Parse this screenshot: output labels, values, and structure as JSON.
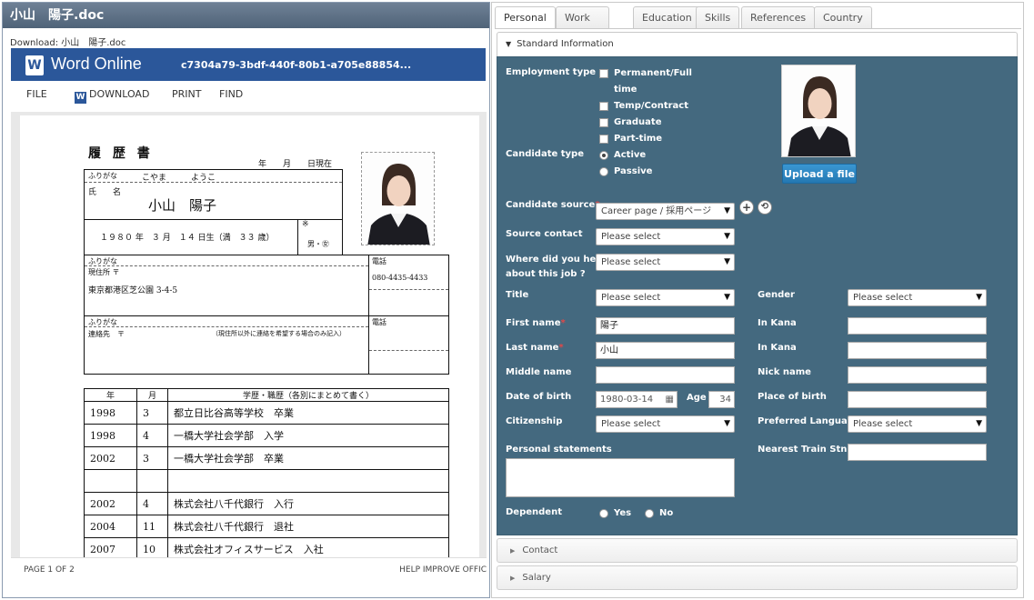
{
  "left": {
    "title": "小山　陽子.doc",
    "download_line": "Download: 小山　陽子.doc",
    "app_name": "Word Online",
    "file_id": "c7304a79-3bdf-440f-80b1-a705e88854...",
    "menu": {
      "file": "FILE",
      "download": "DOWNLOAD",
      "print": "PRINT",
      "find": "FIND"
    },
    "footer": {
      "page": "PAGE 1 OF 2",
      "help": "HELP IMPROVE OFFIC"
    }
  },
  "resume": {
    "heading": "履 歴 書",
    "date_line": "年　　月　　日現在",
    "furigana_label": "ふりがな",
    "furigana_value": "こやま　　　ようこ",
    "name_label": "氏　　名",
    "name_value": "小山　陽子",
    "birth_line": "１９８０ 年　３ 月　１４ 日生（満　３３ 歳）",
    "mark": "※",
    "gender": "男・㊛",
    "address_furigana": "ふりがな",
    "address_label": "現住所 〒",
    "address_value": "東京都港区芝公園 3-4-5",
    "phone_label": "電話",
    "phone_value": "080-4435-4433",
    "contact_furigana": "ふりがな",
    "contact_label": "連絡先　〒",
    "contact_note": "（現住所以外に連絡を希望する場合のみ記入）",
    "phone2_label": "電話",
    "history_headers": [
      "年",
      "月",
      "学歴・職歴（各別にまとめて書く）"
    ],
    "history_rows": [
      [
        "1998",
        "3",
        "都立日比谷高等学校　卒業"
      ],
      [
        "1998",
        "4",
        "一橋大学社会学部　入学"
      ],
      [
        "2002",
        "3",
        "一橋大学社会学部　卒業"
      ],
      [
        "",
        "",
        ""
      ],
      [
        "2002",
        "4",
        "株式会社八千代銀行　入行"
      ],
      [
        "2004",
        "11",
        "株式会社八千代銀行　退社"
      ],
      [
        "2007",
        "10",
        "株式会社オフィスサービス　入社"
      ]
    ]
  },
  "tabs": [
    "Personal",
    "Work History",
    "Education",
    "Skills",
    "References",
    "Country Specific"
  ],
  "standard": {
    "header": "Standard Information",
    "employment_type_label": "Employment type",
    "employment_options": [
      "Permanent/Full",
      "time",
      "Temp/Contract",
      "Graduate",
      "Part-time"
    ],
    "candidate_type_label": "Candidate type",
    "candidate_type_options": [
      "Active",
      "Passive"
    ],
    "candidate_type_selected": "Active",
    "upload_label": "Upload a file",
    "candidate_source_label": "Candidate source",
    "candidate_source_value": "Career page / 採用ページ",
    "source_contact_label": "Source contact",
    "where_heard_label_1": "Where did you hear",
    "where_heard_label_2": "about this job ?",
    "placeholder": "Please select",
    "title_label": "Title",
    "gender_label": "Gender",
    "first_name_label": "First name",
    "first_name_value": "陽子",
    "in_kana_label": "In Kana",
    "last_name_label": "Last name",
    "last_name_value": "小山",
    "middle_name_label": "Middle name",
    "nick_name_label": "Nick name",
    "dob_label": "Date of birth",
    "dob_value": "1980-03-14",
    "age_label": "Age",
    "age_value": "34",
    "place_of_birth_label": "Place of birth",
    "citizenship_label": "Citizenship",
    "preferred_language_label": "Preferred Language",
    "personal_statements_label": "Personal statements",
    "nearest_train_label": "Nearest Train Stn",
    "dependent_label": "Dependent",
    "dependent_yes": "Yes",
    "dependent_no": "No",
    "required_mark": "*"
  },
  "accordions": {
    "contact": "Contact",
    "salary": "Salary"
  }
}
